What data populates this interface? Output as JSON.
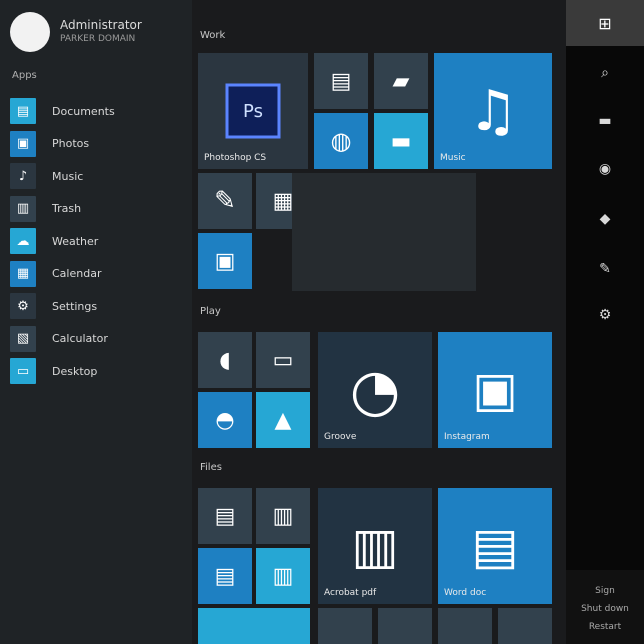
{
  "user": {
    "name": "Administrator",
    "subtitle": "PARKER DOMAIN"
  },
  "left": {
    "section_label": "Apps",
    "apps": [
      {
        "icon": "documents-icon",
        "label": "Documents",
        "color": "#26a7d4"
      },
      {
        "icon": "photos-icon",
        "label": "Photos",
        "color": "#1e80c2"
      },
      {
        "icon": "music-icon",
        "label": "Music",
        "color": "#2b3640"
      },
      {
        "icon": "trash-icon",
        "label": "Trash",
        "color": "#32414d"
      },
      {
        "icon": "weather-icon",
        "label": "Weather",
        "color": "#26a7d4"
      },
      {
        "icon": "calendar-icon",
        "label": "Calendar",
        "color": "#1e80c2"
      },
      {
        "icon": "settings-icon",
        "label": "Settings",
        "color": "#2b3640"
      },
      {
        "icon": "calculator-icon",
        "label": "Calculator",
        "color": "#32414d"
      },
      {
        "icon": "desktop-icon",
        "label": "Desktop",
        "color": "#26a7d4"
      }
    ]
  },
  "groups": {
    "g1_label": "Work",
    "g2_label": "Play",
    "g3_label": "Files"
  },
  "tiles": {
    "photoshop": "Photoshop CS",
    "music": "Music",
    "groove": "Groove",
    "instagram": "Instagram",
    "acrobat": "Acrobat pdf",
    "office": "Word doc"
  },
  "right": {
    "bottom_line1": "Sign",
    "bottom_line2": "Shut down",
    "bottom_line3": "Restart"
  },
  "colors": {
    "accent_blue": "#1e80c2",
    "accent_light_blue": "#26a7d4",
    "tile_slate": "#32414d"
  }
}
